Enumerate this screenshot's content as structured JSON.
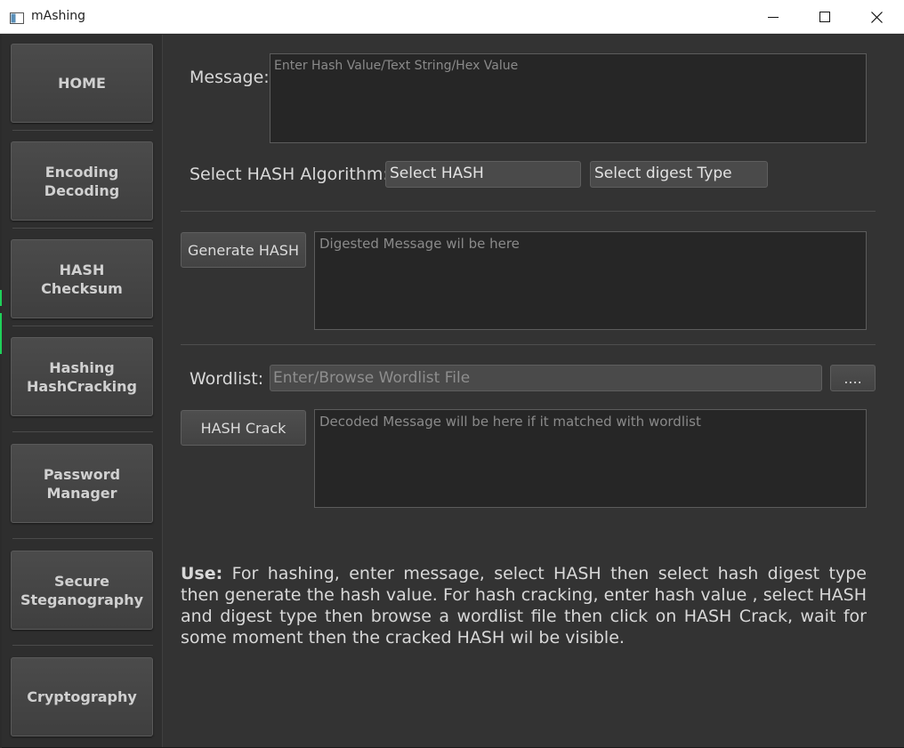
{
  "window": {
    "title": "mAshing",
    "icon": "app-window-icon",
    "controls": [
      "minimize-icon",
      "maximize-icon",
      "close-icon"
    ]
  },
  "sidebar": {
    "items": [
      {
        "label": "HOME"
      },
      {
        "label": "Encoding\nDecoding"
      },
      {
        "label": "HASH\nChecksum"
      },
      {
        "label": "Hashing\nHashCracking"
      },
      {
        "label": "Password\nManager"
      },
      {
        "label": "Secure\nSteganography"
      },
      {
        "label": "Cryptography"
      }
    ]
  },
  "main": {
    "message_label": "Message:",
    "message_placeholder": "Enter Hash Value/Text String/Hex Value",
    "algorithm_label": "Select HASH Algorithm:",
    "hash_select": "Select HASH",
    "digest_select": "Select  digest Type",
    "generate_button": "Generate HASH",
    "digest_placeholder": "Digested Message wil be here",
    "wordlist_label": "Wordlist:",
    "wordlist_placeholder": "Enter/Browse Wordlist File",
    "browse_button": "....",
    "crack_button": "HASH Crack",
    "decoded_placeholder": "Decoded Message will be here if it matched with wordlist",
    "usage_title": "Use:",
    "usage_text": "For hashing, enter message, select HASH then select hash digest type then generate the hash value. For hash cracking, enter hash value , select HASH and digest type then browse a wordlist file then click on HASH Crack, wait for some moment then the cracked HASH wil be visible."
  },
  "colors": {
    "background": "#333333",
    "sidebar": "#2e2e2e",
    "accent": "#1fd05a"
  }
}
